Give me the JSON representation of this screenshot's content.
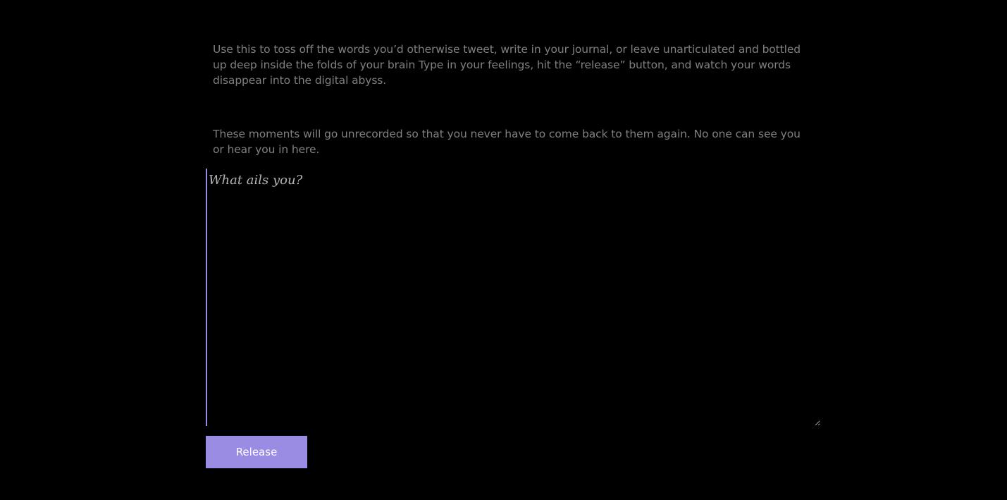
{
  "intro": {
    "paragraph_1": "Use this to toss off the words you’d otherwise tweet, write in your journal, or leave unarticulated and bottled up deep inside the folds of your brain Type in your feelings, hit the “release” button, and watch your words disappear into the digital abyss.",
    "paragraph_2": "These moments will go unrecorded so that you never have to come back to them again. No one can see you or hear you in here."
  },
  "composer": {
    "placeholder": "What ails you?",
    "value": ""
  },
  "actions": {
    "release_label": "Release"
  },
  "colors": {
    "background": "#000000",
    "body_text": "#808080",
    "accent": "#9b8ce3",
    "button_text": "#ffffff"
  }
}
